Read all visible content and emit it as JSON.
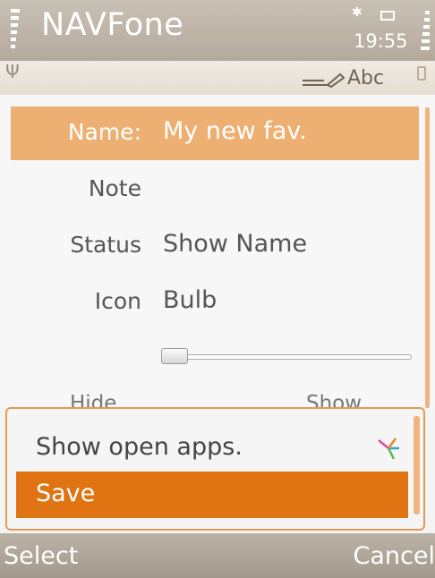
{
  "titlebar": {
    "app_title": "NAVFone",
    "clock": "19:55",
    "bluetooth_icon": "bluetooth-icon"
  },
  "status_strip": {
    "input_mode": "Abc",
    "signal_icon": "antenna-icon",
    "pen_icon": "pen-input-icon"
  },
  "form": {
    "fields": [
      {
        "label": "Name:",
        "value": "My new fav."
      },
      {
        "label": "Note",
        "value": ""
      },
      {
        "label": "Status",
        "value": "Show Name"
      },
      {
        "label": "Icon",
        "value": "Bulb"
      }
    ],
    "slider_level": 0.0,
    "slider_min_label": "Hide",
    "slider_max_label": "Show"
  },
  "popup": {
    "items": [
      {
        "label": "Show open apps.",
        "icon": "open-apps-icon"
      },
      {
        "label": "Save",
        "selected": true
      }
    ]
  },
  "softkeys": {
    "left": "Select",
    "right": "Cancel"
  },
  "colors": {
    "selection_light": "#eeaf72",
    "selection_dark": "#e07412",
    "titlebar": "#b4aa9c",
    "softkey_bar": "#a39a8e"
  }
}
